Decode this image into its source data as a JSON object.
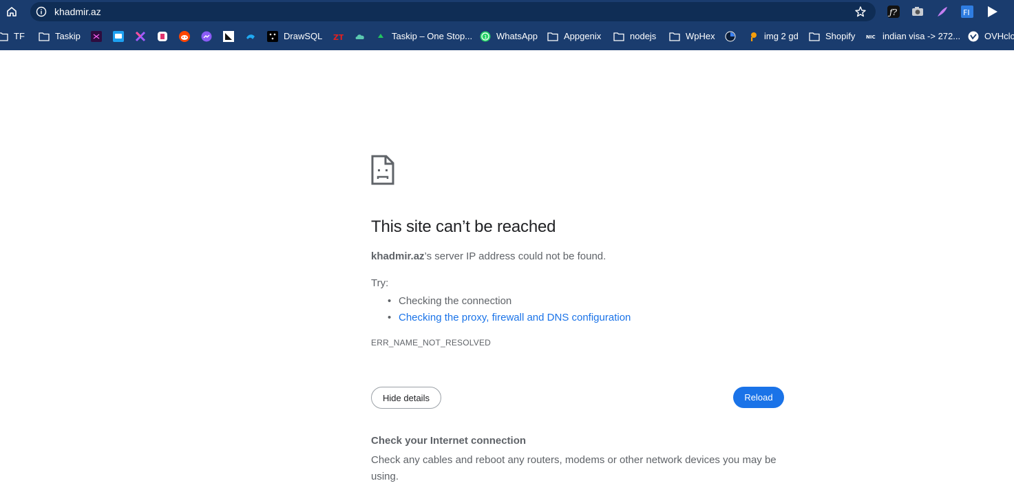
{
  "browser": {
    "url": "khadmir.az",
    "toolbar_icons": [
      "home-icon",
      "site-info-icon",
      "bookmark-star-icon"
    ],
    "extensions": [
      {
        "name": "fonts-ninja-extension-icon",
        "label": "ƒ?"
      },
      {
        "name": "camera-extension-icon",
        "label": ""
      },
      {
        "name": "feather-extension-icon",
        "label": ""
      },
      {
        "name": "font-identifier-extension-icon",
        "label": "F|"
      },
      {
        "name": "play-extension-icon",
        "label": ""
      }
    ]
  },
  "bookmarks": [
    {
      "label": "TF",
      "icon": "folder-icon"
    },
    {
      "label": "Taskip",
      "icon": "folder-icon"
    },
    {
      "label": "",
      "icon": "xd-favicon-icon"
    },
    {
      "label": "",
      "icon": "chat-favicon-icon"
    },
    {
      "label": "",
      "icon": "x-favicon-icon"
    },
    {
      "label": "",
      "icon": "app-favicon-icon"
    },
    {
      "label": "",
      "icon": "reddit-icon"
    },
    {
      "label": "",
      "icon": "messenger-icon"
    },
    {
      "label": "",
      "icon": "penguin-favicon-icon"
    },
    {
      "label": "",
      "icon": "wave-favicon-icon"
    },
    {
      "label": "DrawSQL",
      "icon": "drawsql-icon"
    },
    {
      "label": "",
      "icon": "zt-favicon-icon"
    },
    {
      "label": "",
      "icon": "cloud-favicon-icon"
    },
    {
      "label": "Taskip – One Stop...",
      "icon": "taskip-favicon-icon"
    },
    {
      "label": "WhatsApp",
      "icon": "whatsapp-icon"
    },
    {
      "label": "Appgenix",
      "icon": "folder-icon"
    },
    {
      "label": "nodejs",
      "icon": "folder-icon"
    },
    {
      "label": "WpHex",
      "icon": "folder-icon"
    },
    {
      "label": "",
      "icon": "circle-favicon-icon"
    },
    {
      "label": "img 2 gd",
      "icon": "img2gd-icon"
    },
    {
      "label": "Shopify",
      "icon": "folder-icon"
    },
    {
      "label": "indian visa -> 272...",
      "icon": "nic-favicon-icon"
    },
    {
      "label": "OVHclou",
      "icon": "ovh-icon"
    }
  ],
  "error_page": {
    "icon": "sad-page-icon",
    "title": "This site can’t be reached",
    "host": "khadmir.az",
    "description_rest": "’s server IP address could not be found.",
    "try_label": "Try:",
    "suggestion_1": "Checking the connection",
    "suggestion_2": "Checking the proxy, firewall and DNS configuration",
    "error_code": "ERR_NAME_NOT_RESOLVED",
    "hide_details_label": "Hide details",
    "reload_label": "Reload",
    "details_heading": "Check your Internet connection",
    "details_body": "Check any cables and reboot any routers, modems or other network devices you may be using."
  },
  "colors": {
    "toolbar": "#1a3c6e",
    "omnibox": "#0f2d55",
    "link": "#1a73e8",
    "reload_button": "#1a73e8",
    "text": "#5f6368",
    "title": "#202124"
  }
}
